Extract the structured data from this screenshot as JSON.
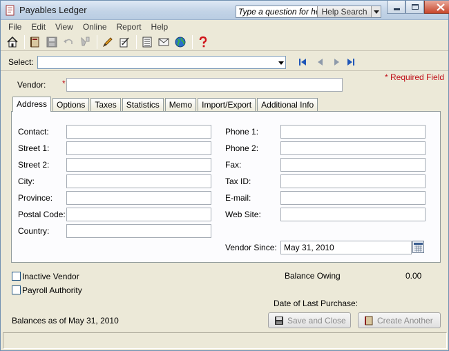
{
  "window": {
    "title": "Payables Ledger",
    "help_placeholder": "Type a question for help",
    "help_search_label": "Help Search"
  },
  "menu": [
    "File",
    "Edit",
    "View",
    "Online",
    "Report",
    "Help"
  ],
  "toolbar": {
    "icons": [
      "home-icon",
      "ledger-icon",
      "save-icon",
      "undo-icon",
      "lookup-icon",
      "edit-icon",
      "memo-icon",
      "calculator-icon",
      "email-icon",
      "globe-icon",
      "help-icon"
    ]
  },
  "select": {
    "label": "Select:",
    "value": ""
  },
  "form": {
    "required_note": "* Required Field",
    "vendor_label": "Vendor:",
    "vendor_required_mark": "*",
    "vendor_value": ""
  },
  "tabs": [
    "Address",
    "Options",
    "Taxes",
    "Statistics",
    "Memo",
    "Import/Export",
    "Additional Info"
  ],
  "address": {
    "left": [
      {
        "label": "Contact:",
        "value": ""
      },
      {
        "label": "Street 1:",
        "value": ""
      },
      {
        "label": "Street 2:",
        "value": ""
      },
      {
        "label": "City:",
        "value": ""
      },
      {
        "label": "Province:",
        "value": ""
      },
      {
        "label": "Postal Code:",
        "value": ""
      },
      {
        "label": "Country:",
        "value": ""
      }
    ],
    "right": [
      {
        "label": "Phone 1:",
        "value": ""
      },
      {
        "label": "Phone 2:",
        "value": ""
      },
      {
        "label": "Fax:",
        "value": ""
      },
      {
        "label": "Tax ID:",
        "value": ""
      },
      {
        "label": "E-mail:",
        "value": ""
      },
      {
        "label": "Web Site:",
        "value": ""
      }
    ],
    "vendor_since_label": "Vendor Since:",
    "vendor_since_value": "May 31, 2010"
  },
  "footer": {
    "inactive_vendor_label": "Inactive Vendor",
    "payroll_authority_label": "Payroll Authority",
    "balance_owing_label": "Balance Owing",
    "balance_owing_value": "0.00",
    "last_purchase_label": "Date of Last Purchase:",
    "balances_as_of": "Balances as of May 31, 2010",
    "save_close_label": "Save and Close",
    "create_another_label": "Create Another"
  }
}
